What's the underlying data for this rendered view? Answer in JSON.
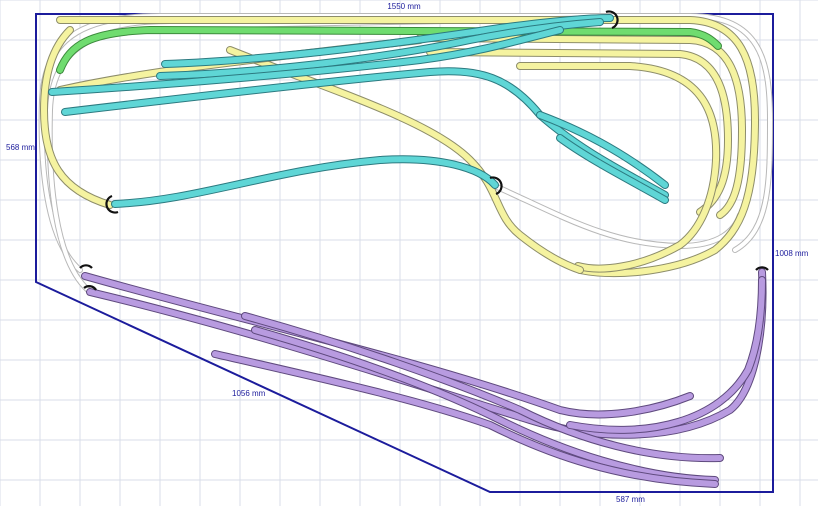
{
  "dimensions": {
    "top_width": "1550 mm",
    "left_height": "568 mm",
    "right_height": "1008 mm",
    "diagonal": "1056 mm",
    "bottom_right": "587 mm"
  },
  "colors": {
    "grid": "#d9dde8",
    "boundary": "#1c1c9c",
    "dimension_text": "#1c1c9c",
    "track_gray": "#ffffff",
    "track_yellow": "#f5f3a0",
    "track_green": "#6fdc6f",
    "track_cyan": "#5fd6d6",
    "track_purple": "#b89be0",
    "bumper": "#111111"
  }
}
